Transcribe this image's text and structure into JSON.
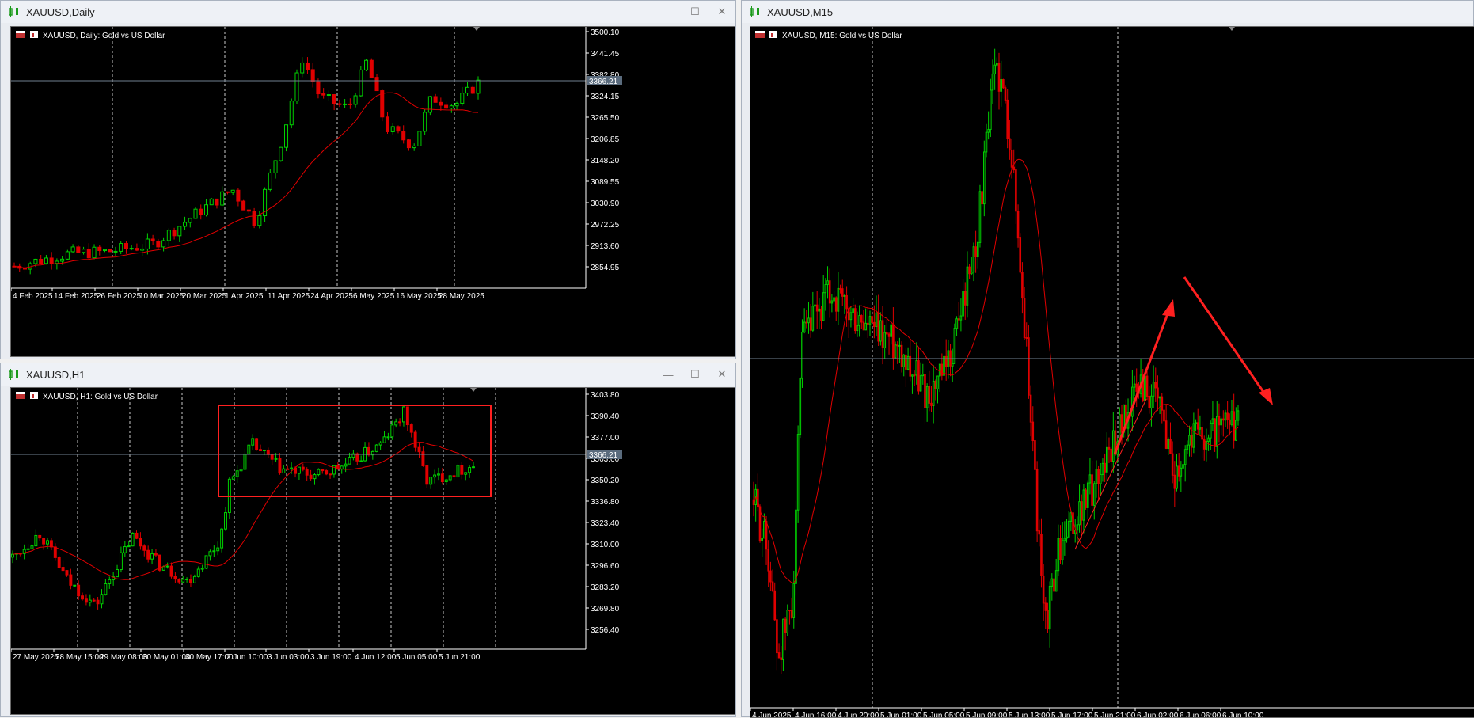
{
  "windows": {
    "daily": {
      "title": "XAUUSD,Daily",
      "label": "XAUUSD, Daily:  Gold vs US Dollar",
      "price_label": "3366.21",
      "y_ticks": [
        "3500.10",
        "3441.45",
        "3382.80",
        "3324.15",
        "3265.50",
        "3206.85",
        "3148.20",
        "3089.55",
        "3030.90",
        "2972.25",
        "2913.60",
        "2854.95"
      ],
      "x_ticks": [
        "4 Feb 2025",
        "14 Feb 2025",
        "26 Feb 2025",
        "10 Mar 2025",
        "20 Mar 2025",
        "1 Apr 2025",
        "11 Apr 2025",
        "24 Apr 2025",
        "6 May 2025",
        "16 May 2025",
        "28 May 2025"
      ]
    },
    "h1": {
      "title": "XAUUSD,H1",
      "label": "XAUUSD, H1:  Gold vs US Dollar",
      "price_label": "3366.21",
      "y_ticks": [
        "3403.80",
        "3390.40",
        "3377.00",
        "3363.60",
        "3350.20",
        "3336.80",
        "3323.40",
        "3310.00",
        "3296.60",
        "3283.20",
        "3269.80",
        "3256.40"
      ],
      "x_ticks": [
        "27 May 2025",
        "28 May 15:00",
        "29 May 08:00",
        "30 May 01:00",
        "30 May 17:00",
        "2 Jun 10:00",
        "3 Jun 03:00",
        "3 Jun 19:00",
        "4 Jun 12:00",
        "5 Jun 05:00",
        "5 Jun 21:00"
      ]
    },
    "m15": {
      "title": "XAUUSD,M15",
      "label": "XAUUSD, M15:  Gold vs US Dollar",
      "x_ticks": [
        "4 Jun 2025",
        "4 Jun 16:00",
        "4 Jun 20:00",
        "5 Jun 01:00",
        "5 Jun 05:00",
        "5 Jun 09:00",
        "5 Jun 13:00",
        "5 Jun 17:00",
        "5 Jun 21:00",
        "6 Jun 02:00",
        "6 Jun 06:00",
        "6 Jun 10:00"
      ]
    }
  },
  "colors": {
    "bull": "#00d000",
    "bear": "#e00000",
    "ma": "#e00000",
    "annotation": "#ff2020",
    "bidline": "#6f7f8f",
    "grid": "#c8c8c8"
  }
}
